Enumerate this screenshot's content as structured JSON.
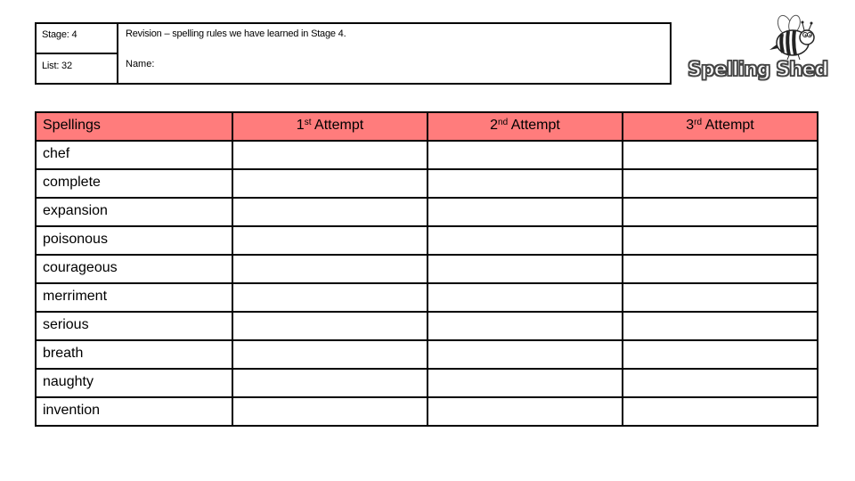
{
  "info": {
    "stage_label": "Stage: 4",
    "list_label": "List: 32",
    "title": "Revision – spelling rules we have learned in Stage 4.",
    "name_label": "Name:"
  },
  "logo": {
    "text": "Spelling Shed",
    "icon": "bee-icon"
  },
  "table": {
    "header_color": "#FF7C7C",
    "headers": {
      "spellings": "Spellings",
      "attempts": [
        {
          "num": "1",
          "suffix": "st",
          "label": " Attempt"
        },
        {
          "num": "2",
          "suffix": "nd",
          "label": " Attempt"
        },
        {
          "num": "3",
          "suffix": "rd",
          "label": " Attempt"
        }
      ]
    },
    "words": [
      "chef",
      "complete",
      "expansion",
      "poisonous",
      "courageous",
      "merriment",
      "serious",
      "breath",
      "naughty",
      "invention"
    ]
  }
}
